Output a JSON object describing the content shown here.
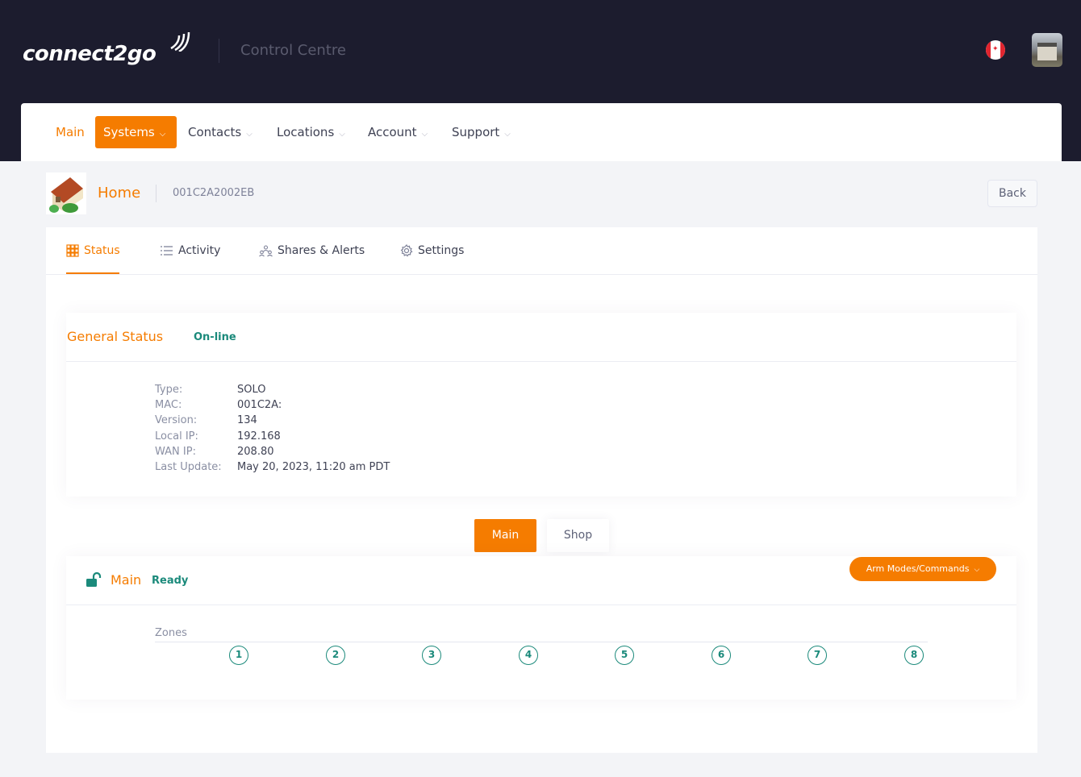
{
  "header": {
    "logo_text": "connect2go",
    "title": "Control Centre",
    "flag": "canada-flag-icon",
    "avatar": "user-avatar"
  },
  "nav": {
    "items": [
      {
        "label": "Main",
        "active": false,
        "has_dropdown": false
      },
      {
        "label": "Systems",
        "active": true,
        "has_dropdown": true
      },
      {
        "label": "Contacts",
        "active": false,
        "has_dropdown": true
      },
      {
        "label": "Locations",
        "active": false,
        "has_dropdown": true
      },
      {
        "label": "Account",
        "active": false,
        "has_dropdown": true
      },
      {
        "label": "Support",
        "active": false,
        "has_dropdown": true
      }
    ]
  },
  "system": {
    "name": "Home",
    "id": "001C2A2002EB",
    "back_label": "Back"
  },
  "tabs": [
    {
      "label": "Status",
      "icon": "grid-icon",
      "active": true
    },
    {
      "label": "Activity",
      "icon": "list-icon",
      "active": false
    },
    {
      "label": "Shares & Alerts",
      "icon": "people-icon",
      "active": false
    },
    {
      "label": "Settings",
      "icon": "gear-icon",
      "active": false
    }
  ],
  "general_status": {
    "title": "General Status",
    "state": "On-line",
    "rows": [
      {
        "label": "Type:",
        "value": "SOLO"
      },
      {
        "label": "MAC:",
        "value": "001C2A:"
      },
      {
        "label": "Version:",
        "value": "134"
      },
      {
        "label": "Local IP:",
        "value": "192.168"
      },
      {
        "label": "WAN IP:",
        "value": "208.80"
      },
      {
        "label": "Last Update:",
        "value": "May 20, 2023, 11:20 am PDT"
      }
    ]
  },
  "partition_selector": {
    "options": [
      "Main",
      "Shop"
    ],
    "selected": "Main"
  },
  "partition": {
    "name": "Main",
    "state": "Ready",
    "lock_icon": "unlocked-icon",
    "arm_button": "Arm Modes/Commands",
    "zones_label": "Zones",
    "zones": [
      "1",
      "2",
      "3",
      "4",
      "5",
      "6",
      "7",
      "8"
    ]
  },
  "colors": {
    "accent": "#f57c00",
    "status_ok": "#1b8a7b",
    "header_bg": "#1c1c2e"
  }
}
